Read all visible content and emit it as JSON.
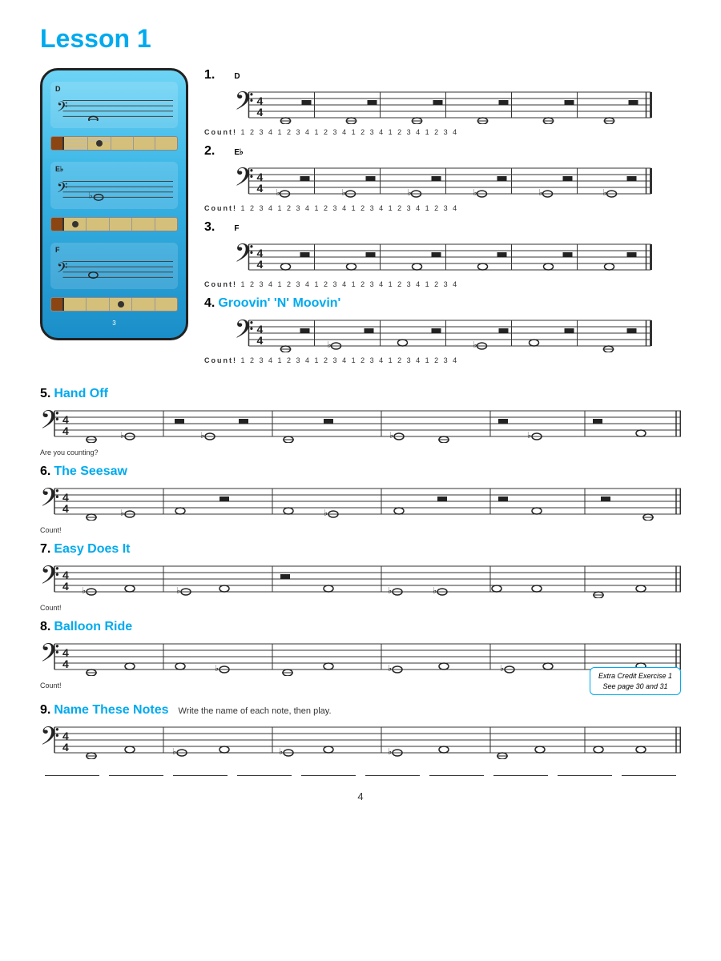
{
  "page": {
    "title": "Lesson 1",
    "page_number": "4"
  },
  "phone_card": {
    "notes": [
      "D",
      "E♭",
      "F"
    ],
    "labels": [
      "D",
      "E♭",
      "F"
    ]
  },
  "exercises": [
    {
      "number": "1.",
      "title": "",
      "note_label": "D",
      "count": "Count!  1  2  3  4    1  2  3  4    1  2  3  4    1  2  3  4    1  2  3  4    1  2  3  4"
    },
    {
      "number": "2.",
      "title": "",
      "note_label": "E♭",
      "count": "Count!  1  2  3  4    1  2  3  4    1  2  3  4    1  2  3  4    1  2  3  4    1  2  3  4"
    },
    {
      "number": "3.",
      "title": "",
      "note_label": "F",
      "count": "Count!  1  2  3  4    1  2  3  4    1  2  3  4    1  2  3  4    1  2  3  4    1  2  3  4"
    },
    {
      "number": "4.",
      "title": "Groovin' 'N' Moovin'",
      "count": "Count!  1  2  3  4    1  2  3  4    1  2  3  4    1  2  3  4    1  2  3  4    1  2  3  4"
    }
  ],
  "full_exercises": [
    {
      "number": "5.",
      "title": "Hand Off",
      "subtitle": "",
      "note": "Are you counting?"
    },
    {
      "number": "6.",
      "title": "The Seesaw",
      "subtitle": "",
      "note": "Count!"
    },
    {
      "number": "7.",
      "title": "Easy Does It",
      "subtitle": "",
      "note": "Count!"
    },
    {
      "number": "8.",
      "title": "Balloon Ride",
      "subtitle": "",
      "note": "Count!"
    },
    {
      "number": "9.",
      "title": "Name These Notes",
      "subtitle": "Write the name of each note, then play.",
      "note": ""
    }
  ],
  "extra_credit": {
    "line1": "Extra Credit Exercise 1",
    "line2": "See page 30 and 31"
  }
}
